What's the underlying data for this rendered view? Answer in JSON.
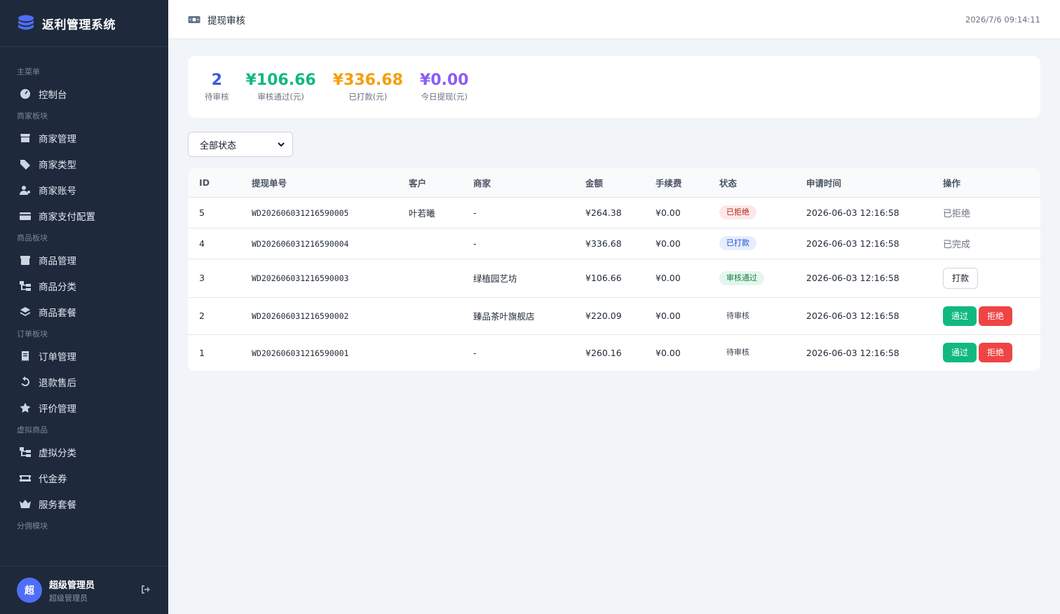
{
  "app": {
    "title": "返利管理系统",
    "colors": {
      "sidebar": "#1e293b",
      "accent": "#4f6ef7"
    }
  },
  "sidebar": {
    "sections": [
      {
        "title": "主菜单",
        "items": [
          {
            "label": "控制台",
            "icon": "dashboard-icon"
          }
        ]
      },
      {
        "title": "商家板块",
        "items": [
          {
            "label": "商家管理",
            "icon": "store-icon"
          },
          {
            "label": "商家类型",
            "icon": "tags-icon"
          },
          {
            "label": "商家账号",
            "icon": "user-key-icon"
          },
          {
            "label": "商家支付配置",
            "icon": "credit-card-icon"
          }
        ]
      },
      {
        "title": "商品板块",
        "items": [
          {
            "label": "商品管理",
            "icon": "box-icon"
          },
          {
            "label": "商品分类",
            "icon": "tree-icon"
          },
          {
            "label": "商品套餐",
            "icon": "layers-icon"
          }
        ]
      },
      {
        "title": "订单板块",
        "items": [
          {
            "label": "订单管理",
            "icon": "receipt-icon"
          },
          {
            "label": "退款售后",
            "icon": "undo-icon"
          },
          {
            "label": "评价管理",
            "icon": "star-icon"
          }
        ]
      },
      {
        "title": "虚拟商品",
        "items": [
          {
            "label": "虚拟分类",
            "icon": "tree-icon"
          },
          {
            "label": "代金券",
            "icon": "ticket-icon"
          },
          {
            "label": "服务套餐",
            "icon": "crown-icon"
          }
        ]
      },
      {
        "title": "分佣模块",
        "items": []
      }
    ],
    "user": {
      "avatar_text": "超",
      "name": "超级管理员",
      "role": "超级管理员"
    }
  },
  "header": {
    "title": "提现审核",
    "time": "2026/7/6 09:14:11"
  },
  "stats": [
    {
      "value": "2",
      "label": "待审核",
      "color": "#3b5bdb"
    },
    {
      "value": "¥106.66",
      "label": "审核通过(元)",
      "color": "#10b981"
    },
    {
      "value": "¥336.68",
      "label": "已打款(元)",
      "color": "#f59e0b"
    },
    {
      "value": "¥0.00",
      "label": "今日提现(元)",
      "color": "#8b5cf6"
    }
  ],
  "filter": {
    "selected": "全部状态"
  },
  "table": {
    "columns": [
      "ID",
      "提现单号",
      "客户",
      "商家",
      "金额",
      "手续费",
      "状态",
      "申请时间",
      "操作"
    ],
    "rows": [
      {
        "id": "5",
        "no": "WD202606031216590005",
        "customer": "叶若曦",
        "merchant": "-",
        "amount": "¥264.38",
        "fee": "¥0.00",
        "status": "已拒绝",
        "status_type": "rejected",
        "time": "2026-06-03 12:16:58",
        "action_text": "已拒绝"
      },
      {
        "id": "4",
        "no": "WD202606031216590004",
        "customer": "",
        "merchant": "-",
        "amount": "¥336.68",
        "fee": "¥0.00",
        "status": "已打款",
        "status_type": "paid",
        "time": "2026-06-03 12:16:58",
        "action_text": "已完成"
      },
      {
        "id": "3",
        "no": "WD202606031216590003",
        "customer": "",
        "merchant": "绿植园艺坊",
        "amount": "¥106.66",
        "fee": "¥0.00",
        "status": "审核通过",
        "status_type": "approved",
        "time": "2026-06-03 12:16:58",
        "action_button": "打款"
      },
      {
        "id": "2",
        "no": "WD202606031216590002",
        "customer": "",
        "merchant": "臻品茶叶旗舰店",
        "amount": "¥220.09",
        "fee": "¥0.00",
        "status": "待审核",
        "status_type": "pending",
        "time": "2026-06-03 12:16:58",
        "approve": "通过",
        "reject": "拒绝"
      },
      {
        "id": "1",
        "no": "WD202606031216590001",
        "customer": "",
        "merchant": "-",
        "amount": "¥260.16",
        "fee": "¥0.00",
        "status": "待审核",
        "status_type": "pending",
        "time": "2026-06-03 12:16:58",
        "approve": "通过",
        "reject": "拒绝"
      }
    ]
  }
}
